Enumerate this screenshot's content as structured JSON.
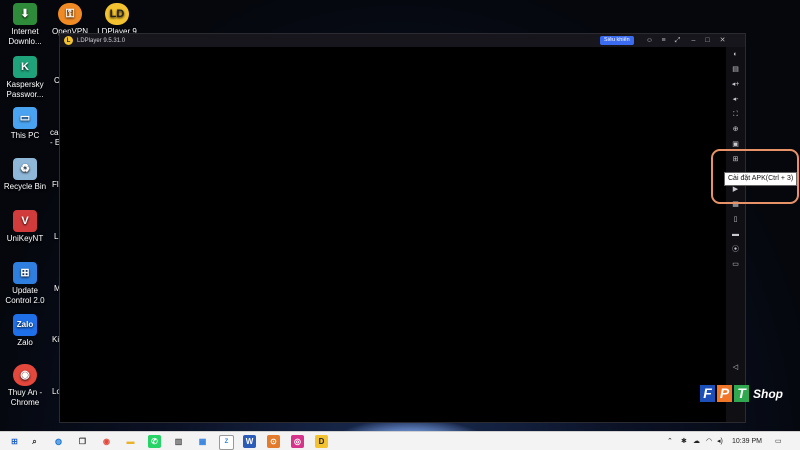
{
  "desktop": {
    "icons": [
      {
        "label": "Internet Downlo...",
        "icon": "internet-download-manager-icon",
        "color": "#2e8b3a"
      },
      {
        "label": "OpenVPN",
        "icon": "openvpn-icon",
        "color": "#f08a24"
      },
      {
        "label": "LDPlayer 9",
        "icon": "ldplayer-icon",
        "color": "#f2c230"
      },
      {
        "label": "Kaspersky Passwor...",
        "icon": "kaspersky-icon",
        "color": "#1fa37a"
      },
      {
        "label": "This PC",
        "icon": "this-pc-icon",
        "color": "#4aa3f0"
      },
      {
        "label": "Recycle Bin",
        "icon": "recycle-bin-icon",
        "color": "#8fb7d8"
      },
      {
        "label": "UniKeyNT",
        "icon": "unikey-icon",
        "color": "#d23b3b"
      },
      {
        "label": "Update Control 2.0",
        "icon": "update-control-icon",
        "color": "#2f7fe0"
      },
      {
        "label": "Zalo",
        "icon": "zalo-icon",
        "color": "#1e6fe8"
      },
      {
        "label": "Thuy An - Chrome",
        "icon": "chrome-icon",
        "color": "#e4473c"
      }
    ],
    "cut_labels": [
      "C",
      "cal",
      "- E",
      "Fl",
      "L",
      "M",
      "Ki",
      "Lo"
    ]
  },
  "ldplayer": {
    "title": "LDPlayer 9.5.31.0",
    "update_label": "Siêu khiển",
    "title_buttons": [
      "user-icon",
      "menu-icon",
      "expand-icon",
      "minimize-icon",
      "maximize-icon",
      "close-icon"
    ],
    "sidebar_icons": [
      "keyboard-icon",
      "gamepad-icon",
      "volume-up-icon",
      "volume-down-icon",
      "fullscreen-icon",
      "lock-icon",
      "screenshot-icon",
      "install-apk-icon",
      "record-icon",
      "folder-icon",
      "operations-icon",
      "location-icon",
      "multi-instance-icon"
    ],
    "tooltip": "Cài đặt APK(Ctrl + 3)"
  },
  "watermark": {
    "letters": [
      "F",
      "P",
      "T"
    ],
    "shop": "Shop",
    "colors": [
      "#1d4fb8",
      "#f0762a",
      "#2fa84f"
    ]
  },
  "taskbar": {
    "apps": [
      "windows-start-icon",
      "search-icon",
      "edge-icon",
      "task-view-icon",
      "chrome-icon",
      "file-explorer-icon",
      "whatsapp-icon",
      "books-icon",
      "word-icon",
      "zoom-icon",
      "word-doc-icon",
      "ldplayer-icon",
      "instagram-icon",
      "ldplayer9-icon"
    ],
    "time": "10:39 PM"
  }
}
